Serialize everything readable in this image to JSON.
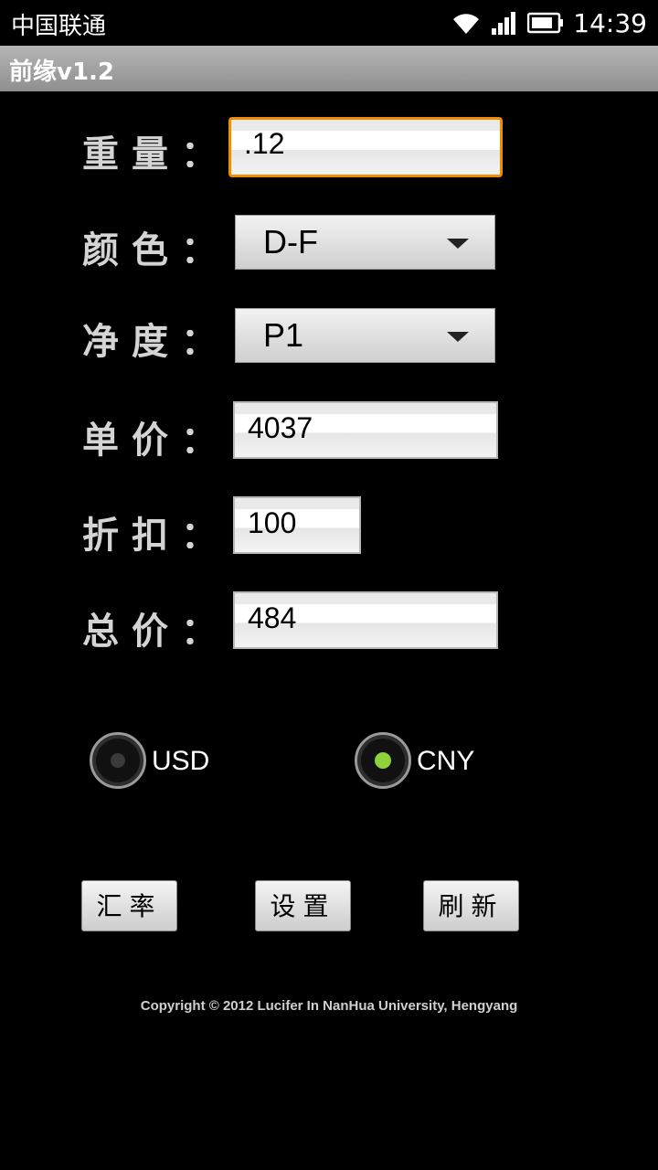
{
  "status_bar": {
    "carrier": "中国联通",
    "time": "14:39",
    "icons": [
      "wifi-icon",
      "signal-icon",
      "battery-icon"
    ]
  },
  "app": {
    "title": "前缘v1.2"
  },
  "form": {
    "weight": {
      "label": "重量：",
      "value": ".12"
    },
    "color": {
      "label": "颜色：",
      "selected": "D-F"
    },
    "clarity": {
      "label": "净度：",
      "selected": "P1"
    },
    "unit_price": {
      "label": "单价：",
      "value": "4037"
    },
    "discount": {
      "label": "折扣：",
      "value": "100"
    },
    "total_price": {
      "label": "总价：",
      "value": "484"
    }
  },
  "currency": {
    "options": [
      {
        "label": "USD",
        "checked": false
      },
      {
        "label": "CNY",
        "checked": true
      }
    ]
  },
  "buttons": {
    "exchange_rate": "汇率",
    "settings": "设置",
    "refresh": "刷新"
  },
  "footer": {
    "copyright": "Copyright © 2012 Lucifer In NanHua University, Hengyang"
  },
  "colors": {
    "focus": "#f28c00",
    "radio_checked": "#8fd13a",
    "title_bar": "#a3a3a3"
  }
}
